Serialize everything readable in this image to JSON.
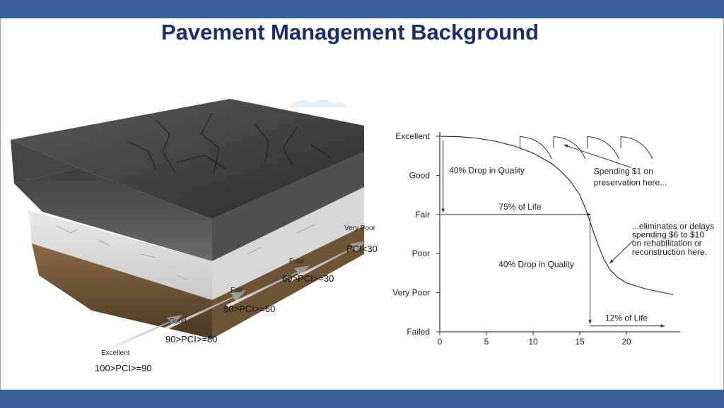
{
  "slide": {
    "title": "Pavement Management Background"
  },
  "pavement_block": {
    "labels": [
      {
        "condition": "Excellent",
        "range": "100>PCI>=90"
      },
      {
        "condition": "Good",
        "range": "90>PCI>=80"
      },
      {
        "condition": "Fair",
        "range": "80>PCI>=60"
      },
      {
        "condition": "Poor",
        "range": "60>PCI>=30"
      },
      {
        "condition": "Very Poor",
        "range": "PCI<30"
      }
    ]
  },
  "chart_data": {
    "type": "line",
    "title": "",
    "xlabel": "",
    "ylabel": "",
    "xlim": [
      0,
      25
    ],
    "x_ticks": [
      "0",
      "5",
      "10",
      "15",
      "20"
    ],
    "x_tick_values": [
      0,
      5,
      10,
      15,
      20
    ],
    "y_categories": [
      "Excellent",
      "Good",
      "Fair",
      "Poor",
      "Very Poor",
      "Failed"
    ],
    "y_category_values": [
      5,
      4,
      3,
      2,
      1,
      0
    ],
    "series": [
      {
        "x": [
          0,
          2,
          4,
          6,
          8,
          10,
          12,
          13,
          14,
          15,
          15.7,
          16.4,
          17,
          17.6,
          18.2,
          19,
          20,
          22,
          25
        ],
        "y": [
          5,
          4.99,
          4.95,
          4.87,
          4.75,
          4.57,
          4.3,
          4.1,
          3.85,
          3.5,
          3.1,
          2.6,
          2.2,
          1.85,
          1.6,
          1.4,
          1.25,
          1.1,
          0.95
        ]
      }
    ],
    "annotations": {
      "drop_quality_top": "40% Drop in Quality",
      "life_75": "75% of Life",
      "drop_quality_bottom": "40% Drop in Quality",
      "life_12": "12% of Life",
      "spending_line1": "Spending $1 on",
      "spending_line2": "preservation here...",
      "eliminates_line1": "...eliminates or delays",
      "eliminates_line2": "spending $6 to $10",
      "eliminates_line3": "on rehabilitation or",
      "eliminates_line4": "reconstruction here."
    },
    "grid": false
  },
  "colors": {
    "banner": "#3a5e96",
    "title": "#1b2d6b"
  }
}
